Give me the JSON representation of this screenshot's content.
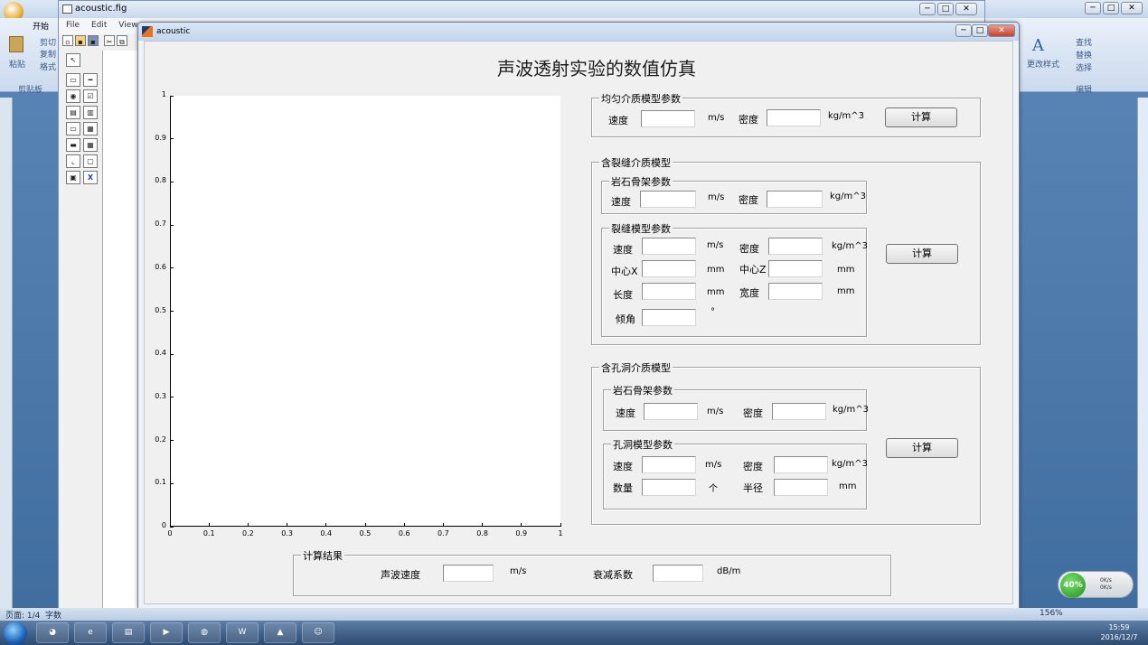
{
  "word": {
    "home_tab": "开始",
    "clipboard_group": "剪贴板",
    "paste_label": "粘贴",
    "format_painter": "格式",
    "cut": "剪切",
    "copy": "复制",
    "change_styles": "更改样式",
    "find": "查找",
    "replace": "替换",
    "select": "选择",
    "edit_group": "编辑",
    "status_page": "页面: 1/4",
    "status_words": "字数",
    "zoom": "156%"
  },
  "guide": {
    "title": "acoustic.fig",
    "menu": [
      "File",
      "Edit",
      "View"
    ]
  },
  "figure": {
    "window_title": "acoustic",
    "main_title": "声波透射实验的数值仿真",
    "uniform": {
      "title": "均匀介质模型参数",
      "speed_label": "速度",
      "speed_unit": "m/s",
      "density_label": "密度",
      "density_unit": "kg/m^3",
      "compute": "计算"
    },
    "crack": {
      "title": "含裂缝介质模型",
      "rock_title": "岩石骨架参数",
      "rock_speed_label": "速度",
      "rock_speed_unit": "m/s",
      "rock_density_label": "密度",
      "rock_density_unit": "kg/m^3",
      "model_title": "裂缝模型参数",
      "speed_label": "速度",
      "speed_unit": "m/s",
      "density_label": "密度",
      "density_unit": "kg/m^3",
      "cx_label": "中心X",
      "cx_unit": "mm",
      "cz_label": "中心Z",
      "cz_unit": "mm",
      "length_label": "长度",
      "length_unit": "mm",
      "width_label": "宽度",
      "width_unit": "mm",
      "angle_label": "倾角",
      "angle_unit": "°",
      "compute": "计算"
    },
    "pore": {
      "title": "含孔洞介质模型",
      "rock_title": "岩石骨架参数",
      "rock_speed_label": "速度",
      "rock_speed_unit": "m/s",
      "rock_density_label": "密度",
      "rock_density_unit": "kg/m^3",
      "model_title": "孔洞模型参数",
      "speed_label": "速度",
      "speed_unit": "m/s",
      "density_label": "密度",
      "density_unit": "kg/m^3",
      "count_label": "数量",
      "count_unit": "个",
      "radius_label": "半径",
      "radius_unit": "mm",
      "compute": "计算"
    },
    "result": {
      "title": "计算结果",
      "speed_label": "声波速度",
      "speed_unit": "m/s",
      "atten_label": "衰减系数",
      "atten_unit": "dB/m"
    }
  },
  "chart_data": {
    "type": "line",
    "series": [],
    "xlim": [
      0,
      1
    ],
    "ylim": [
      0,
      1
    ],
    "xticks": [
      "0",
      "0.1",
      "0.2",
      "0.3",
      "0.4",
      "0.5",
      "0.6",
      "0.7",
      "0.8",
      "0.9",
      "1"
    ],
    "yticks": [
      "0",
      "0.1",
      "0.2",
      "0.3",
      "0.4",
      "0.5",
      "0.6",
      "0.7",
      "0.8",
      "0.9",
      "1"
    ],
    "grid": false
  },
  "taskbar": {
    "clock_time": "15:59",
    "clock_date": "2016/12/7",
    "net_percent": "40%",
    "net_up": "0K/s",
    "net_down": "0K/s"
  }
}
